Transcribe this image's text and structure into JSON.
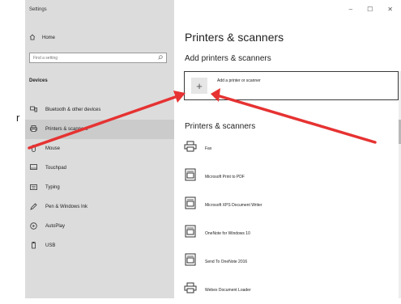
{
  "left_fragment": {
    "text": "r"
  },
  "window": {
    "title": "Settings",
    "controls": [
      "–",
      "☐",
      "✕"
    ]
  },
  "sidebar": {
    "home_label": "Home",
    "search_placeholder": "Find a setting",
    "section_label": "Devices",
    "items": [
      {
        "label": "Bluetooth & other devices",
        "icon": "bluetooth-devices-icon",
        "selected": false
      },
      {
        "label": "Printers & scanners",
        "icon": "printer-icon",
        "selected": true
      },
      {
        "label": "Mouse",
        "icon": "mouse-icon",
        "selected": false
      },
      {
        "label": "Touchpad",
        "icon": "touchpad-icon",
        "selected": false
      },
      {
        "label": "Typing",
        "icon": "keyboard-icon",
        "selected": false
      },
      {
        "label": "Pen & Windows Ink",
        "icon": "pen-icon",
        "selected": false
      },
      {
        "label": "AutoPlay",
        "icon": "autoplay-icon",
        "selected": false
      },
      {
        "label": "USB",
        "icon": "usb-icon",
        "selected": false
      }
    ]
  },
  "main": {
    "title": "Printers & scanners",
    "add_section_title": "Add printers & scanners",
    "add_button_label": "Add a printer or scanner",
    "list_title": "Printers & scanners",
    "printers": [
      {
        "name": "Fax",
        "icon": "printer-icon"
      },
      {
        "name": "Microsoft Print to PDF",
        "icon": "document-printer-icon"
      },
      {
        "name": "Microsoft XPS Document Writer",
        "icon": "document-printer-icon"
      },
      {
        "name": "OneNote for Windows 10",
        "icon": "document-printer-icon"
      },
      {
        "name": "Send To OneNote 2016",
        "icon": "document-printer-icon"
      },
      {
        "name": "Webex Document Loader",
        "icon": "printer-icon"
      }
    ]
  },
  "colors": {
    "sidebar_bg": "#dcdcdc",
    "selected_bg": "#cbcbcb",
    "arrow": "#e63232"
  }
}
